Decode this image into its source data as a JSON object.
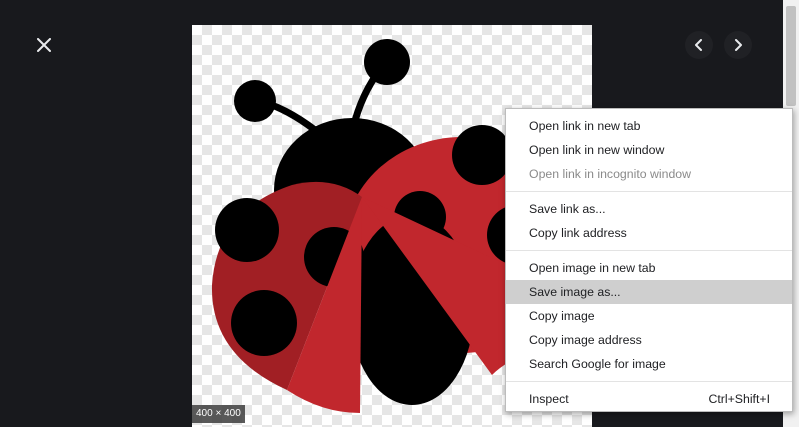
{
  "viewer": {
    "image_dimensions": "400 × 400",
    "icons": {
      "close": "close-icon",
      "prev": "chevron-left-icon",
      "next": "chevron-right-icon",
      "image": "ladybug-image"
    }
  },
  "context_menu": {
    "groups": [
      [
        {
          "label": "Open link in new tab",
          "disabled": false
        },
        {
          "label": "Open link in new window",
          "disabled": false
        },
        {
          "label": "Open link in incognito window",
          "disabled": true
        }
      ],
      [
        {
          "label": "Save link as...",
          "disabled": false
        },
        {
          "label": "Copy link address",
          "disabled": false
        }
      ],
      [
        {
          "label": "Open image in new tab",
          "disabled": false
        },
        {
          "label": "Save image as...",
          "disabled": false,
          "highlighted": true
        },
        {
          "label": "Copy image",
          "disabled": false
        },
        {
          "label": "Copy image address",
          "disabled": false
        },
        {
          "label": "Search Google for image",
          "disabled": false
        }
      ],
      [
        {
          "label": "Inspect",
          "shortcut": "Ctrl+Shift+I",
          "disabled": false
        }
      ]
    ]
  },
  "colors": {
    "background": "#18191d",
    "ladybug_red": "#c1272d",
    "ladybug_dark_red": "#a11f24",
    "ladybug_black": "#000000",
    "menu_highlight": "#cfcfcf"
  }
}
